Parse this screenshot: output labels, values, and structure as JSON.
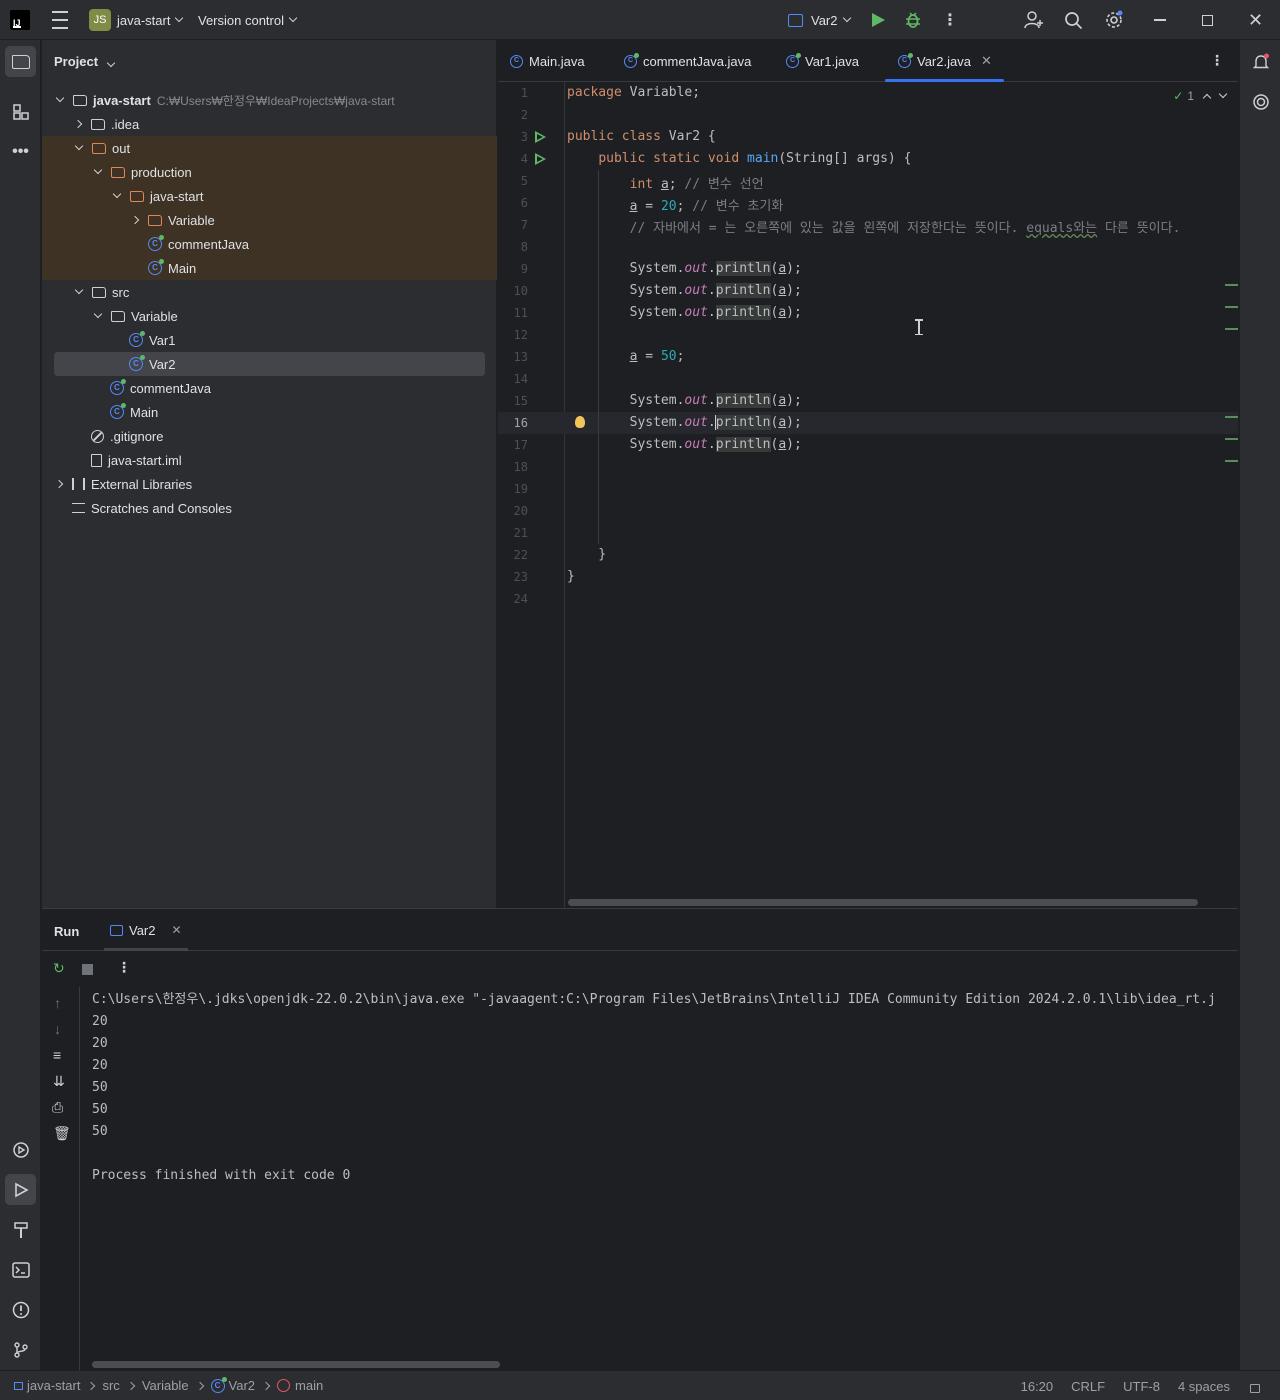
{
  "titlebar": {
    "project_badge": "JS",
    "project_name": "java-start",
    "vcs": "Version control",
    "run_config": "Var2"
  },
  "project_panel": {
    "title": "Project",
    "tree": [
      {
        "label": "java-start",
        "hint": "C:₩Users₩한정우₩IdeaProjects₩java-start",
        "depth": 0,
        "arrow": "open",
        "icon": "module"
      },
      {
        "label": ".idea",
        "depth": 1,
        "arrow": "closed",
        "icon": "folder"
      },
      {
        "label": "out",
        "depth": 1,
        "arrow": "open",
        "icon": "folder-orange"
      },
      {
        "label": "production",
        "depth": 2,
        "arrow": "open",
        "icon": "folder-orange"
      },
      {
        "label": "java-start",
        "depth": 3,
        "arrow": "open",
        "icon": "folder-orange"
      },
      {
        "label": "Variable",
        "depth": 4,
        "arrow": "closed",
        "icon": "folder-orange"
      },
      {
        "label": "commentJava",
        "depth": 4,
        "arrow": "none",
        "icon": "class"
      },
      {
        "label": "Main",
        "depth": 4,
        "arrow": "none",
        "icon": "class"
      },
      {
        "label": "src",
        "depth": 1,
        "arrow": "open",
        "icon": "folder"
      },
      {
        "label": "Variable",
        "depth": 2,
        "arrow": "open",
        "icon": "package"
      },
      {
        "label": "Var1",
        "depth": 3,
        "arrow": "none",
        "icon": "class"
      },
      {
        "label": "Var2",
        "depth": 3,
        "arrow": "none",
        "icon": "class"
      },
      {
        "label": "commentJava",
        "depth": 2,
        "arrow": "none",
        "icon": "class"
      },
      {
        "label": "Main",
        "depth": 2,
        "arrow": "none",
        "icon": "class"
      },
      {
        "label": ".gitignore",
        "depth": 1,
        "arrow": "none",
        "icon": "ignore"
      },
      {
        "label": "java-start.iml",
        "depth": 1,
        "arrow": "none",
        "icon": "file"
      },
      {
        "label": "External Libraries",
        "depth": 0,
        "arrow": "closed",
        "icon": "library"
      },
      {
        "label": "Scratches and Consoles",
        "depth": 0,
        "arrow": "none",
        "icon": "scratch"
      }
    ]
  },
  "editor": {
    "tabs": [
      "Main.java",
      "commentJava.java",
      "Var1.java",
      "Var2.java"
    ],
    "active_tab": "Var2.java",
    "inspection_count": "1",
    "current_line": 16,
    "line_numbers": [
      "1",
      "2",
      "3",
      "4",
      "5",
      "6",
      "7",
      "8",
      "9",
      "10",
      "11",
      "12",
      "13",
      "14",
      "15",
      "16",
      "17",
      "18",
      "19",
      "20",
      "21",
      "22",
      "23",
      "24"
    ],
    "code_lines": [
      "package Variable;",
      "",
      "public class Var2 {",
      "    public static void main(String[] args) {",
      "        int a; // 변수 선언",
      "        a = 20; // 변수 초기화",
      "        // 자바에서 = 는 오른쪽에 있는 값을 왼쪽에 저장한다는 뜻이다. equals와는 다른 뜻이다.",
      "",
      "        System.out.println(a);",
      "        System.out.println(a);",
      "        System.out.println(a);",
      "",
      "        a = 50;",
      "",
      "        System.out.println(a);",
      "        System.out.println(a);",
      "        System.out.println(a);",
      "",
      "",
      "",
      "",
      "    }",
      "}",
      ""
    ]
  },
  "run": {
    "title": "Run",
    "tab": "Var2",
    "output": [
      "C:\\Users\\한정우\\.jdks\\openjdk-22.0.2\\bin\\java.exe \"-javaagent:C:\\Program Files\\JetBrains\\IntelliJ IDEA Community Edition 2024.2.0.1\\lib\\idea_rt.j",
      "20",
      "20",
      "20",
      "50",
      "50",
      "50",
      "",
      "Process finished with exit code 0"
    ]
  },
  "status": {
    "breadcrumbs": [
      "java-start",
      "src",
      "Variable",
      "Var2",
      "main"
    ],
    "position": "16:20",
    "line_sep": "CRLF",
    "encoding": "UTF-8",
    "indent": "4 spaces"
  },
  "colors": {
    "accent": "#3574f0",
    "run_green": "#5fb865",
    "excluded_bg": "#3d3223"
  }
}
